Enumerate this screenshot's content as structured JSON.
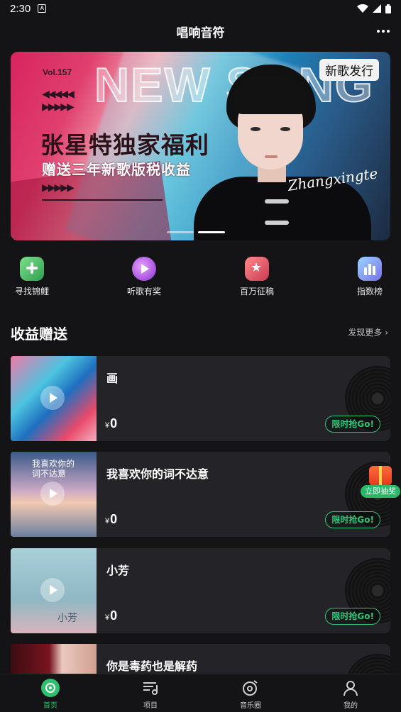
{
  "status_bar": {
    "time": "2:30",
    "notification_glyph": "A",
    "icons": [
      "wifi-icon",
      "signal-icon",
      "battery-icon"
    ]
  },
  "app_bar": {
    "title": "唱响音符",
    "more_icon": "more-dots-icon"
  },
  "banner": {
    "vol": "Vol.157",
    "bg_text": "NEW SONG PF",
    "headline": "张星特独家福利",
    "subheadline": "赠送三年新歌版税收益",
    "tag": "新歌发行",
    "signature": "Zhangxingte",
    "page_dots": 2,
    "active_dot": 1
  },
  "quick_actions": [
    {
      "label": "寻找锦鲤",
      "icon": "game-controller-icon",
      "color": "#3fbf6a"
    },
    {
      "label": "听歌有奖",
      "icon": "play-disc-icon",
      "color": "#b04de0"
    },
    {
      "label": "百万征稿",
      "icon": "star-box-icon",
      "color": "#e0566a"
    },
    {
      "label": "指数榜",
      "icon": "bar-chart-icon",
      "color": "#6fb6e6"
    }
  ],
  "section": {
    "title": "收益赠送",
    "more": "发现更多 ›"
  },
  "songs": [
    {
      "title": "画",
      "currency": "¥",
      "price": "0",
      "action": "限时抢Go!"
    },
    {
      "title": "我喜欢你的词不达意",
      "currency": "¥",
      "price": "0",
      "action": "限时抢Go!",
      "cover_text": "我喜欢你的词不达意"
    },
    {
      "title": "小芳",
      "currency": "¥",
      "price": "0",
      "action": "限时抢Go!",
      "cover_text": "小芳"
    },
    {
      "title": "你是毒药也是解药"
    }
  ],
  "floating": {
    "label": "立即抽奖",
    "icon": "gift-box-icon"
  },
  "tabs": [
    {
      "label": "首页",
      "icon": "home-disc-icon",
      "active": true
    },
    {
      "label": "项目",
      "icon": "playlist-icon",
      "active": false
    },
    {
      "label": "音乐圈",
      "icon": "music-circle-icon",
      "active": false
    },
    {
      "label": "我的",
      "icon": "user-icon",
      "active": false
    }
  ],
  "colors": {
    "background": "#141416",
    "card": "#242428",
    "accent": "#2fc06f"
  }
}
